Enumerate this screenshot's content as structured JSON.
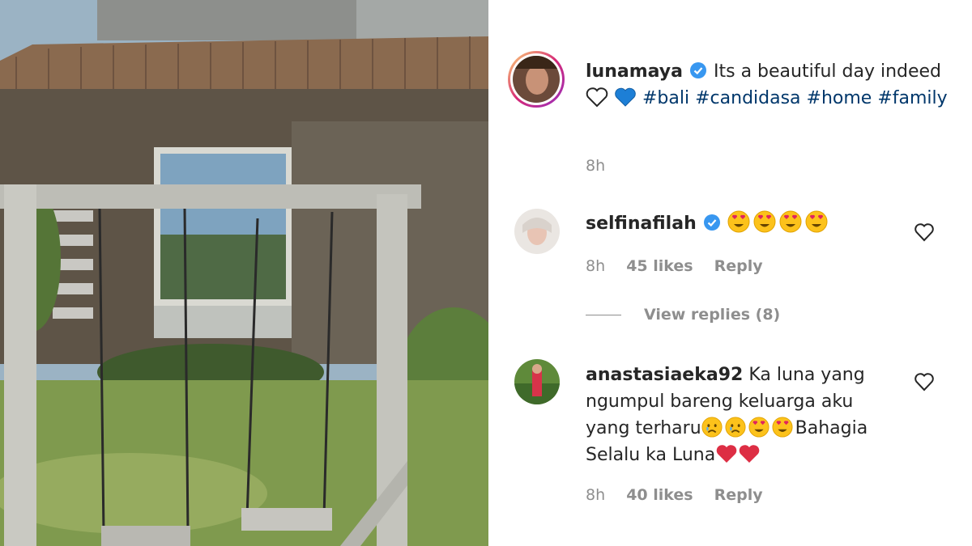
{
  "post": {
    "author": "lunamaya",
    "caption_text": "Its a beautiful day indeed",
    "hashtags": [
      "#bali",
      "#candidasa",
      "#home",
      "#family"
    ],
    "time": "8h",
    "icons": [
      "white-heart-icon",
      "blue-heart-icon",
      "verified-badge-icon"
    ]
  },
  "comments": [
    {
      "username": "selfinafilah",
      "verified": true,
      "emojis": [
        "heart-eyes",
        "heart-eyes",
        "heart-eyes",
        "heart-eyes"
      ],
      "time": "8h",
      "likes": "45 likes",
      "reply_label": "Reply",
      "view_replies": "View replies (8)"
    },
    {
      "username": "anastasiaeka92",
      "verified": false,
      "line1": "Ka luna yang",
      "line2": "ngumpul bareng keluarga aku",
      "line3_a": "yang terharu",
      "line3_b": "Bahagia",
      "line4": "Selalu ka Luna",
      "emojis": [
        "crying",
        "crying",
        "heart-eyes",
        "heart-eyes",
        "red-heart",
        "red-heart"
      ],
      "time": "8h",
      "likes": "40 likes",
      "reply_label": "Reply"
    }
  ],
  "colors": {
    "text": "#262626",
    "muted": "#8e8e8e",
    "hashtag": "#00376b",
    "verified": "#3897f0",
    "story_ring": "#c13584"
  }
}
